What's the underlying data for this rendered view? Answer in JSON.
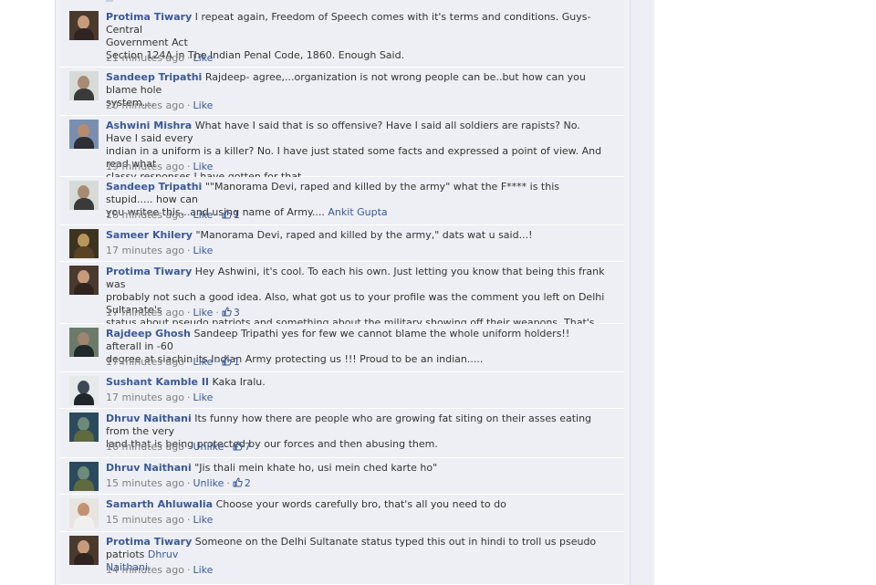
{
  "colors": {
    "link": "#3b5998",
    "comment_bg": "#edeff4",
    "meta": "#808080"
  },
  "comments": [
    {
      "author": "Protima Tiwary",
      "lines": [
        "I repeat again, Freedom of Speech comes with it's terms and conditions. Guys- Central",
        "Government Act",
        "Section 124A in The Indian Penal Code, 1860. Enough Said."
      ],
      "time": "21 minutes ago",
      "action": "Like",
      "avatar": "avatar-protima"
    },
    {
      "author": "Sandeep Tripathi",
      "lines": [
        "Rajdeep- agree,...organization is not wrong people can be..but how can you blame hole",
        "system...."
      ],
      "time": "20 minutes ago",
      "action": "Like",
      "avatar": "avatar-sandeep"
    },
    {
      "author": "Ashwini Mishra",
      "lines": [
        "What have I said that is so offensive? Have I said all soldiers are rapists? No. Have I said every",
        "indian in a uniform is a killer? No. I have just stated some facts and expressed a point of view. And read what",
        "classy responses I have gotten for that."
      ],
      "time": "19 minutes ago",
      "action": "Like",
      "avatar": "avatar-ashwini"
    },
    {
      "author": "Sandeep Tripathi",
      "lines": [
        "\"\"Manorama Devi, raped and killed by the army\" what the F**** is this stupid..... how can",
        "you writee this...and using name of Army...."
      ],
      "mention": "Ankit Gupta",
      "time": "18 minutes ago",
      "action": "Like",
      "likes": "1",
      "avatar": "avatar-sandeep"
    },
    {
      "author": "Sameer Khilery",
      "lines": [
        "\"Manorama Devi, raped and killed by the army,\" dats wat u said...!"
      ],
      "time": "17 minutes ago",
      "action": "Like",
      "avatar": "avatar-sameer"
    },
    {
      "author": "Protima Tiwary",
      "lines": [
        "Hey Ashwini, it's cool. To each his own. Just letting you know that being this frank was",
        "probably not such a good idea. Also, what got us to your profile was the comment you left on Delhi Sultanate's",
        "status about pseudo patriots and something about the military showing off their weapons. That's all."
      ],
      "time": "17 minutes ago",
      "action": "Like",
      "likes": "3",
      "avatar": "avatar-protima"
    },
    {
      "author": "Rajdeep Ghosh",
      "lines": [
        "Sandeep Tripathi yes for few we cannot blame the whole uniform holders!! afterall in -60",
        "degree at siachin its Indian Army protecting us !!! Proud to be an indian....."
      ],
      "time": "17 minutes ago",
      "action": "Like",
      "likes": "1",
      "avatar": "avatar-rajdeep"
    },
    {
      "author": "Sushant Kamble II",
      "lines": [
        "Kaka Iralu."
      ],
      "time": "17 minutes ago",
      "action": "Like",
      "avatar": "avatar-sushant"
    },
    {
      "author": "Dhruv Naithani",
      "lines": [
        "Its funny how there are people who are growing fat siting on their asses eating from the very",
        "land that is being protected by our forces and then abusing them."
      ],
      "time": "16 minutes ago",
      "action": "Unlike",
      "likes": "7",
      "avatar": "avatar-dhruv"
    },
    {
      "author": "Dhruv Naithani",
      "lines": [
        "\"Jis thali mein khate ho, usi mein ched karte ho\""
      ],
      "time": "15 minutes ago",
      "action": "Unlike",
      "likes": "2",
      "avatar": "avatar-dhruv"
    },
    {
      "author": "Samarth Ahluwalia",
      "lines": [
        "Choose your words carefully bro, that's all you need to do"
      ],
      "time": "15 minutes ago",
      "action": "Like",
      "avatar": "avatar-samarth"
    },
    {
      "author": "Protima Tiwary",
      "lines": [
        "Someone on the Delhi Sultanate status typed this out in hindi to troll us pseudo patriots"
      ],
      "mention": "Dhruv",
      "lines_after": [
        "Naithani."
      ],
      "time": "14 minutes ago",
      "action": "Like",
      "avatar": "avatar-protima"
    }
  ]
}
